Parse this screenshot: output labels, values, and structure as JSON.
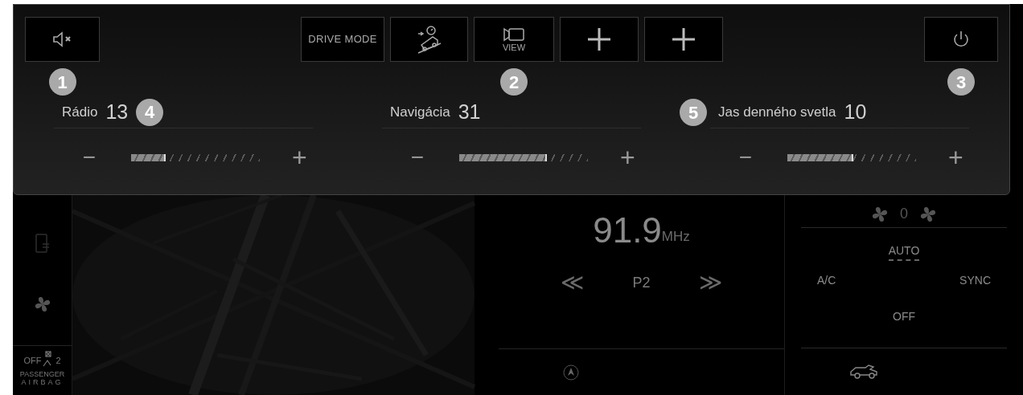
{
  "quick_panel": {
    "left_buttons": [
      {
        "kind": "mute",
        "marker": "1"
      }
    ],
    "center_buttons": [
      {
        "kind": "text",
        "label": "DRIVE MODE"
      },
      {
        "kind": "hill"
      },
      {
        "kind": "camera",
        "label": "VIEW",
        "marker": "2"
      },
      {
        "kind": "add"
      },
      {
        "kind": "add"
      }
    ],
    "right_buttons": [
      {
        "kind": "power",
        "marker": "3"
      }
    ],
    "sliders": [
      {
        "label": "Rádio",
        "value": "13",
        "level": 0.27,
        "marker_after": "4",
        "minus": "−",
        "plus": "+"
      },
      {
        "label": "Navigácia",
        "value": "31",
        "level": 0.68,
        "minus": "−",
        "plus": "+"
      },
      {
        "label": "Jas denného svetla",
        "value": "10",
        "level": 0.51,
        "marker_before": "5",
        "minus": "−",
        "plus": "+"
      }
    ]
  },
  "sidebar": {
    "airbag": {
      "state": "OFF",
      "seat": "2",
      "line1": "PASSENGER",
      "line2": "AIRBAG"
    }
  },
  "radio": {
    "frequency": "91.9",
    "unit": "MHz",
    "prev": "≪",
    "preset": "P2",
    "next": "≫"
  },
  "climate": {
    "fan_speed": "0",
    "auto": "AUTO",
    "ac": "A/C",
    "sync": "SYNC",
    "off": "OFF"
  }
}
